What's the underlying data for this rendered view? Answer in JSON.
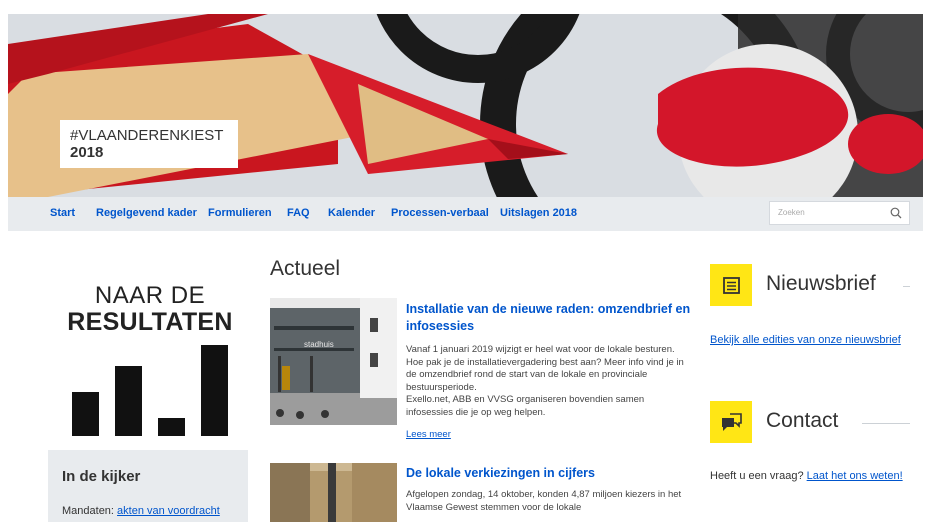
{
  "hero": {
    "line1": "#VLAANDERENKIEST",
    "line2": "2018"
  },
  "nav": {
    "items": [
      "Start",
      "Regelgevend kader",
      "Formulieren",
      "FAQ",
      "Kalender",
      "Processen-verbaal",
      "Uitslagen 2018"
    ],
    "search_placeholder": "Zoeken",
    "search_icon": "search-icon"
  },
  "results": {
    "line1": "NAAR DE",
    "line2": "RESULTATEN"
  },
  "kijker": {
    "title": "In de kijker",
    "text_prefix": "Mandaten: ",
    "link": "akten van voordracht"
  },
  "actueel": {
    "title": "Actueel",
    "articles": [
      {
        "title": "Installatie van de nieuwe raden: omzendbrief en infosessies",
        "body1": "Vanaf 1 januari 2019 wijzigt er heel wat voor de lokale besturen. Hoe pak je de installatievergadering best aan? Meer info vind je in de omzendbrief rond de start van de lokale en provinciale bestuursperiode.",
        "body2": "Exello.net, ABB en VVSG organiseren bovendien samen infosessies die je op weg helpen.",
        "more": "Lees meer",
        "image_text": "stadhuis"
      },
      {
        "title": "De lokale verkiezingen in cijfers",
        "body1": "Afgelopen zondag, 14 oktober, konden 4,87 miljoen kiezers in het Vlaamse Gewest stemmen voor de lokale"
      }
    ]
  },
  "sidebar": {
    "newsletter": {
      "title": "Nieuwsbrief",
      "icon": "newspaper-icon",
      "link": "Bekijk alle edities van onze nieuwsbrief"
    },
    "contact": {
      "title": "Contact",
      "icon": "chat-icon",
      "text": "Heeft u een vraag? ",
      "link": "Laat het ons weten!"
    }
  },
  "colors": {
    "link": "#0055cc",
    "accent_yellow": "#ffe615",
    "panel_grey": "#e8ebee",
    "pencil_red": "#d3162a"
  }
}
